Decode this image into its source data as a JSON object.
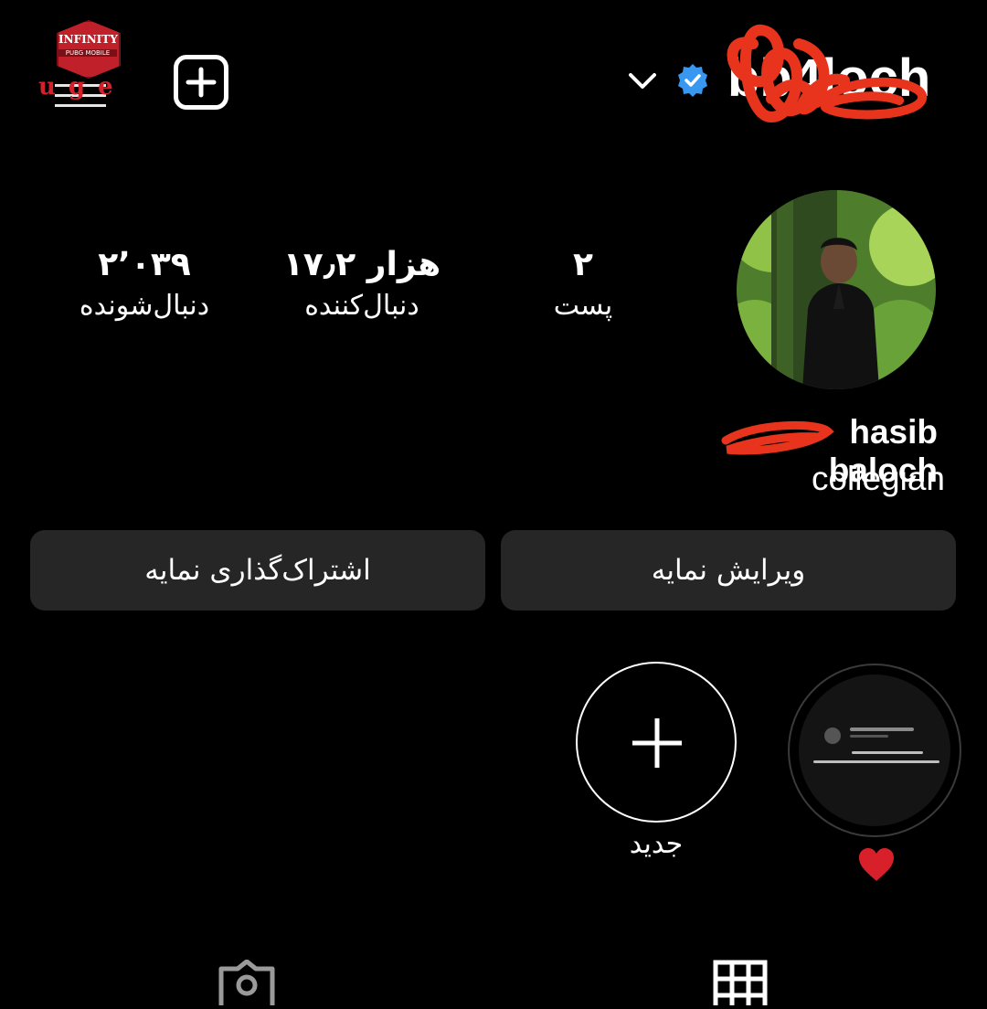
{
  "header": {
    "logo_line1": "INFINITY",
    "logo_line2": "PUBG MOBILE",
    "logo_letters": "uge",
    "username": "bb4loch",
    "colors": {
      "background": "#000000",
      "verified_blue": "#3897f0",
      "button_bg": "#262626",
      "redaction_red": "#e8341c"
    }
  },
  "stats": {
    "posts": {
      "value": "۲",
      "label": "پست"
    },
    "followers": {
      "value": "۱۷٫۲ هزار",
      "label": "دنبال‌کننده"
    },
    "following": {
      "value": "۲٬۰۳۹",
      "label": "دنبال‌شونده"
    }
  },
  "profile": {
    "full_name": "hasib baloch",
    "bio": "collegian"
  },
  "buttons": {
    "edit": "ویرایش نمایه",
    "share": "اشتراک‌گذاری نمایه"
  },
  "highlights": {
    "new_label": "جدید",
    "story_label": "❤️"
  },
  "icons": [
    "menu-icon",
    "add-post-icon",
    "chevron-down-icon",
    "verified-icon",
    "plus-icon",
    "heart-icon",
    "tagged-icon",
    "grid-icon"
  ]
}
